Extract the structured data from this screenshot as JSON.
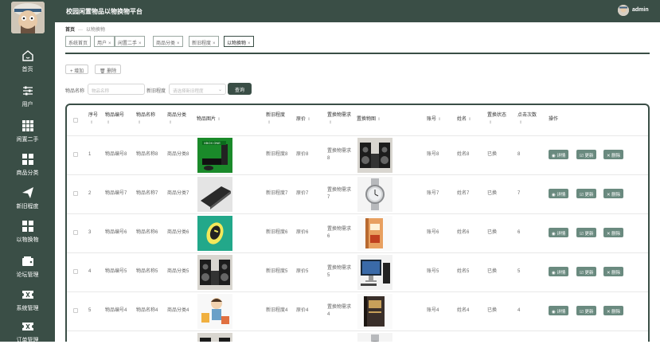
{
  "header": {
    "title": "校园闲置物品以物换物平台",
    "username": "admin"
  },
  "sidebar": {
    "items": [
      {
        "label": "首页",
        "icon": "home-icon"
      },
      {
        "label": "用户",
        "icon": "sliders-icon"
      },
      {
        "label": "闲置二手",
        "icon": "grid-icon"
      },
      {
        "label": "商品分类",
        "icon": "apps-icon"
      },
      {
        "label": "新旧程度",
        "icon": "send-icon"
      },
      {
        "label": "以物换物",
        "icon": "apps-icon"
      },
      {
        "label": "论坛管理",
        "icon": "wallet-icon"
      },
      {
        "label": "系统管理",
        "icon": "ticket-icon"
      },
      {
        "label": "订单管理",
        "icon": "ticket-icon"
      }
    ]
  },
  "breadcrumb": {
    "home": "首页",
    "current": "以物换物"
  },
  "tabs": [
    {
      "label": "系统首页",
      "closable": false
    },
    {
      "label": "用户",
      "closable": true
    },
    {
      "label": "闲置二手",
      "closable": true
    },
    {
      "label": "商品分类",
      "closable": true
    },
    {
      "label": "新旧程度",
      "closable": true
    },
    {
      "label": "以物换物",
      "closable": true,
      "active": true
    }
  ],
  "toolbar": {
    "add_label": "增加",
    "delete_label": "删除"
  },
  "search": {
    "name_label": "物品名称",
    "name_placeholder": "物品名称",
    "condition_label": "新旧程度",
    "condition_placeholder": "请选择新旧程度",
    "query_label": "查询"
  },
  "table": {
    "columns": [
      "序号",
      "物品编号",
      "物品名称",
      "商品分类",
      "物品图片",
      "新旧程度",
      "原价",
      "置换物需求",
      "置换物图",
      "账号",
      "姓名",
      "置换状态",
      "点击次数",
      "操作"
    ],
    "actions": {
      "detail": "详情",
      "update": "更新",
      "delete": "删除"
    },
    "rows": [
      {
        "idx": "1",
        "code": "物品编号8",
        "name": "物品名称8",
        "category": "商品分类8",
        "image": "xbox-console",
        "condition": "新旧程度8",
        "price": "原价8",
        "need": "置换物需求8",
        "need_image": "speakers",
        "account": "账号8",
        "person": "姓名8",
        "status": "已换",
        "clicks": "8"
      },
      {
        "idx": "2",
        "code": "物品编号7",
        "name": "物品名称7",
        "category": "商品分类7",
        "image": "laptop",
        "condition": "新旧程度7",
        "price": "原价7",
        "need": "置换物需求7",
        "need_image": "watch",
        "account": "账号7",
        "person": "姓名7",
        "status": "已换",
        "clicks": "7"
      },
      {
        "idx": "3",
        "code": "物品编号6",
        "name": "物品名称6",
        "category": "商品分类6",
        "image": "mouse",
        "condition": "新旧程度6",
        "price": "原价6",
        "need": "置换物需求6",
        "need_image": "book",
        "account": "账号6",
        "person": "姓名6",
        "status": "已换",
        "clicks": "6"
      },
      {
        "idx": "4",
        "code": "物品编号5",
        "name": "物品名称5",
        "category": "商品分类5",
        "image": "speakers",
        "condition": "新旧程度5",
        "price": "原价5",
        "need": "置换物需求5",
        "need_image": "desktop-pc",
        "account": "账号5",
        "person": "姓名5",
        "status": "已换",
        "clicks": "5"
      },
      {
        "idx": "5",
        "code": "物品编号4",
        "name": "物品名称4",
        "category": "商品分类4",
        "image": "cartoon",
        "condition": "新旧程度4",
        "price": "原价4",
        "need": "置换物需求4",
        "need_image": "book-dark",
        "account": "账号4",
        "person": "姓名4",
        "status": "已换",
        "clicks": "4"
      }
    ]
  },
  "colors": {
    "primary": "#3a4e46",
    "action_button": "#6a8a7f"
  }
}
